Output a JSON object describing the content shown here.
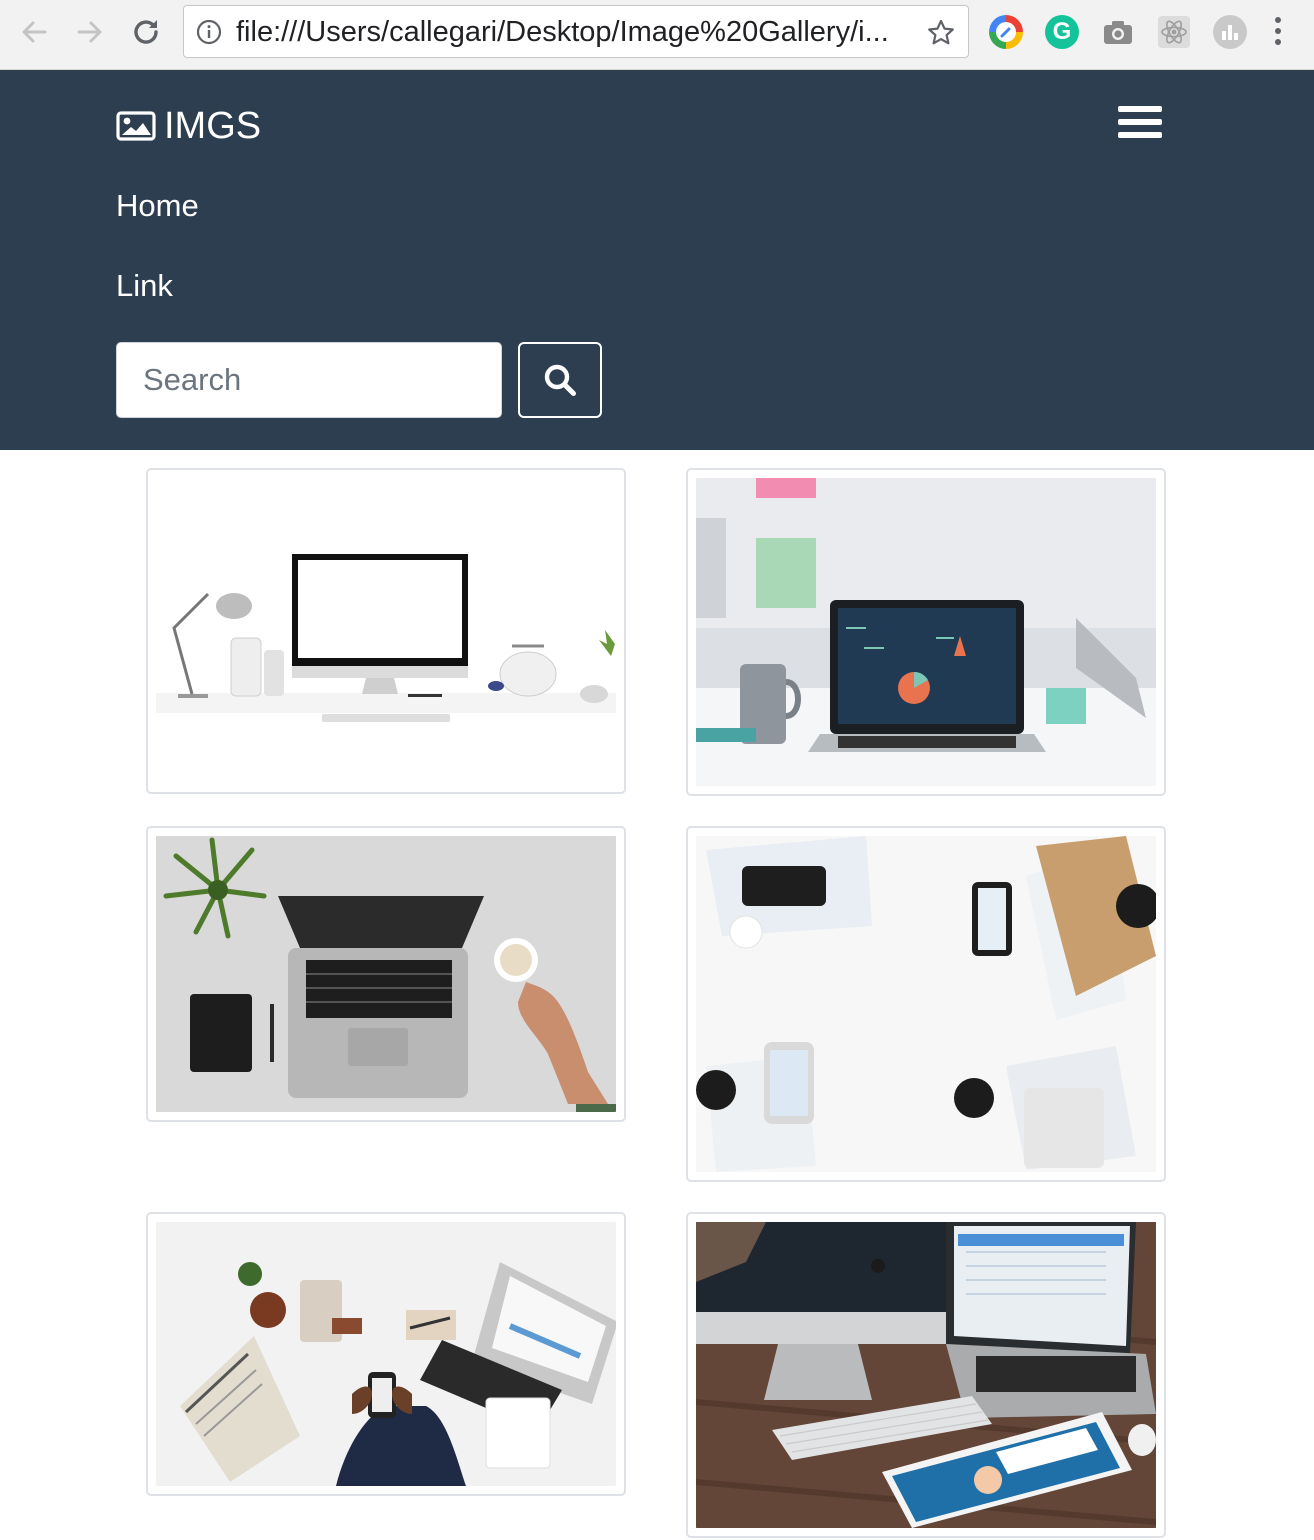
{
  "browser": {
    "url": "file:///Users/callegari/Desktop/Image%20Gallery/i...",
    "extensions": [
      "color-picker-icon",
      "grammarly-icon",
      "camera-icon",
      "react-icon",
      "stats-icon"
    ]
  },
  "navbar": {
    "brand": "IMGS",
    "links": [
      "Home",
      "Link"
    ],
    "search_placeholder": "Search",
    "background_color": "#2c3e50"
  },
  "gallery": {
    "images": [
      {
        "subject": "white desk with iMac, lamp and kettle"
      },
      {
        "subject": "laptop showing infographic on office desk"
      },
      {
        "subject": "top-down laptop with plant, notebook and coffee"
      },
      {
        "subject": "phones and coffee cups on white table"
      },
      {
        "subject": "business desk with newspaper, phone and laptop"
      },
      {
        "subject": "iMac, MacBook and iPad on wooden desk"
      }
    ]
  }
}
